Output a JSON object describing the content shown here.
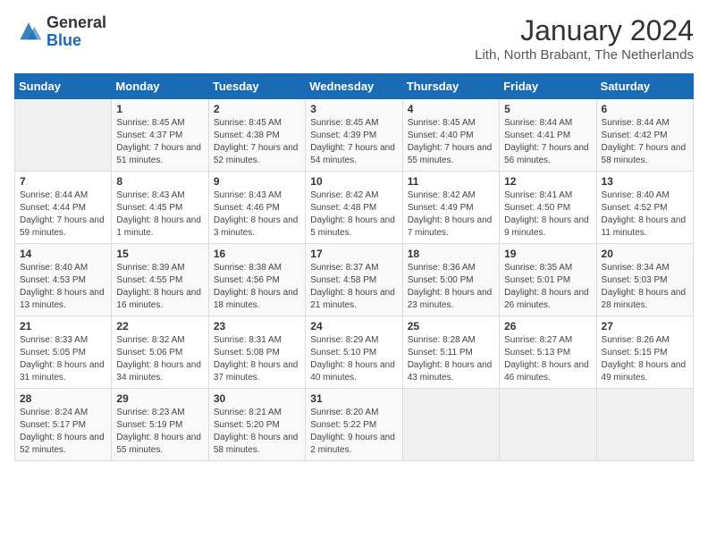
{
  "logo": {
    "general": "General",
    "blue": "Blue"
  },
  "title": "January 2024",
  "subtitle": "Lith, North Brabant, The Netherlands",
  "days_of_week": [
    "Sunday",
    "Monday",
    "Tuesday",
    "Wednesday",
    "Thursday",
    "Friday",
    "Saturday"
  ],
  "weeks": [
    [
      {
        "day": "",
        "sunrise": "",
        "sunset": "",
        "daylight": ""
      },
      {
        "day": "1",
        "sunrise": "Sunrise: 8:45 AM",
        "sunset": "Sunset: 4:37 PM",
        "daylight": "Daylight: 7 hours and 51 minutes."
      },
      {
        "day": "2",
        "sunrise": "Sunrise: 8:45 AM",
        "sunset": "Sunset: 4:38 PM",
        "daylight": "Daylight: 7 hours and 52 minutes."
      },
      {
        "day": "3",
        "sunrise": "Sunrise: 8:45 AM",
        "sunset": "Sunset: 4:39 PM",
        "daylight": "Daylight: 7 hours and 54 minutes."
      },
      {
        "day": "4",
        "sunrise": "Sunrise: 8:45 AM",
        "sunset": "Sunset: 4:40 PM",
        "daylight": "Daylight: 7 hours and 55 minutes."
      },
      {
        "day": "5",
        "sunrise": "Sunrise: 8:44 AM",
        "sunset": "Sunset: 4:41 PM",
        "daylight": "Daylight: 7 hours and 56 minutes."
      },
      {
        "day": "6",
        "sunrise": "Sunrise: 8:44 AM",
        "sunset": "Sunset: 4:42 PM",
        "daylight": "Daylight: 7 hours and 58 minutes."
      }
    ],
    [
      {
        "day": "7",
        "sunrise": "Sunrise: 8:44 AM",
        "sunset": "Sunset: 4:44 PM",
        "daylight": "Daylight: 7 hours and 59 minutes."
      },
      {
        "day": "8",
        "sunrise": "Sunrise: 8:43 AM",
        "sunset": "Sunset: 4:45 PM",
        "daylight": "Daylight: 8 hours and 1 minute."
      },
      {
        "day": "9",
        "sunrise": "Sunrise: 8:43 AM",
        "sunset": "Sunset: 4:46 PM",
        "daylight": "Daylight: 8 hours and 3 minutes."
      },
      {
        "day": "10",
        "sunrise": "Sunrise: 8:42 AM",
        "sunset": "Sunset: 4:48 PM",
        "daylight": "Daylight: 8 hours and 5 minutes."
      },
      {
        "day": "11",
        "sunrise": "Sunrise: 8:42 AM",
        "sunset": "Sunset: 4:49 PM",
        "daylight": "Daylight: 8 hours and 7 minutes."
      },
      {
        "day": "12",
        "sunrise": "Sunrise: 8:41 AM",
        "sunset": "Sunset: 4:50 PM",
        "daylight": "Daylight: 8 hours and 9 minutes."
      },
      {
        "day": "13",
        "sunrise": "Sunrise: 8:40 AM",
        "sunset": "Sunset: 4:52 PM",
        "daylight": "Daylight: 8 hours and 11 minutes."
      }
    ],
    [
      {
        "day": "14",
        "sunrise": "Sunrise: 8:40 AM",
        "sunset": "Sunset: 4:53 PM",
        "daylight": "Daylight: 8 hours and 13 minutes."
      },
      {
        "day": "15",
        "sunrise": "Sunrise: 8:39 AM",
        "sunset": "Sunset: 4:55 PM",
        "daylight": "Daylight: 8 hours and 16 minutes."
      },
      {
        "day": "16",
        "sunrise": "Sunrise: 8:38 AM",
        "sunset": "Sunset: 4:56 PM",
        "daylight": "Daylight: 8 hours and 18 minutes."
      },
      {
        "day": "17",
        "sunrise": "Sunrise: 8:37 AM",
        "sunset": "Sunset: 4:58 PM",
        "daylight": "Daylight: 8 hours and 21 minutes."
      },
      {
        "day": "18",
        "sunrise": "Sunrise: 8:36 AM",
        "sunset": "Sunset: 5:00 PM",
        "daylight": "Daylight: 8 hours and 23 minutes."
      },
      {
        "day": "19",
        "sunrise": "Sunrise: 8:35 AM",
        "sunset": "Sunset: 5:01 PM",
        "daylight": "Daylight: 8 hours and 26 minutes."
      },
      {
        "day": "20",
        "sunrise": "Sunrise: 8:34 AM",
        "sunset": "Sunset: 5:03 PM",
        "daylight": "Daylight: 8 hours and 28 minutes."
      }
    ],
    [
      {
        "day": "21",
        "sunrise": "Sunrise: 8:33 AM",
        "sunset": "Sunset: 5:05 PM",
        "daylight": "Daylight: 8 hours and 31 minutes."
      },
      {
        "day": "22",
        "sunrise": "Sunrise: 8:32 AM",
        "sunset": "Sunset: 5:06 PM",
        "daylight": "Daylight: 8 hours and 34 minutes."
      },
      {
        "day": "23",
        "sunrise": "Sunrise: 8:31 AM",
        "sunset": "Sunset: 5:08 PM",
        "daylight": "Daylight: 8 hours and 37 minutes."
      },
      {
        "day": "24",
        "sunrise": "Sunrise: 8:29 AM",
        "sunset": "Sunset: 5:10 PM",
        "daylight": "Daylight: 8 hours and 40 minutes."
      },
      {
        "day": "25",
        "sunrise": "Sunrise: 8:28 AM",
        "sunset": "Sunset: 5:11 PM",
        "daylight": "Daylight: 8 hours and 43 minutes."
      },
      {
        "day": "26",
        "sunrise": "Sunrise: 8:27 AM",
        "sunset": "Sunset: 5:13 PM",
        "daylight": "Daylight: 8 hours and 46 minutes."
      },
      {
        "day": "27",
        "sunrise": "Sunrise: 8:26 AM",
        "sunset": "Sunset: 5:15 PM",
        "daylight": "Daylight: 8 hours and 49 minutes."
      }
    ],
    [
      {
        "day": "28",
        "sunrise": "Sunrise: 8:24 AM",
        "sunset": "Sunset: 5:17 PM",
        "daylight": "Daylight: 8 hours and 52 minutes."
      },
      {
        "day": "29",
        "sunrise": "Sunrise: 8:23 AM",
        "sunset": "Sunset: 5:19 PM",
        "daylight": "Daylight: 8 hours and 55 minutes."
      },
      {
        "day": "30",
        "sunrise": "Sunrise: 8:21 AM",
        "sunset": "Sunset: 5:20 PM",
        "daylight": "Daylight: 8 hours and 58 minutes."
      },
      {
        "day": "31",
        "sunrise": "Sunrise: 8:20 AM",
        "sunset": "Sunset: 5:22 PM",
        "daylight": "Daylight: 9 hours and 2 minutes."
      },
      {
        "day": "",
        "sunrise": "",
        "sunset": "",
        "daylight": ""
      },
      {
        "day": "",
        "sunrise": "",
        "sunset": "",
        "daylight": ""
      },
      {
        "day": "",
        "sunrise": "",
        "sunset": "",
        "daylight": ""
      }
    ]
  ]
}
